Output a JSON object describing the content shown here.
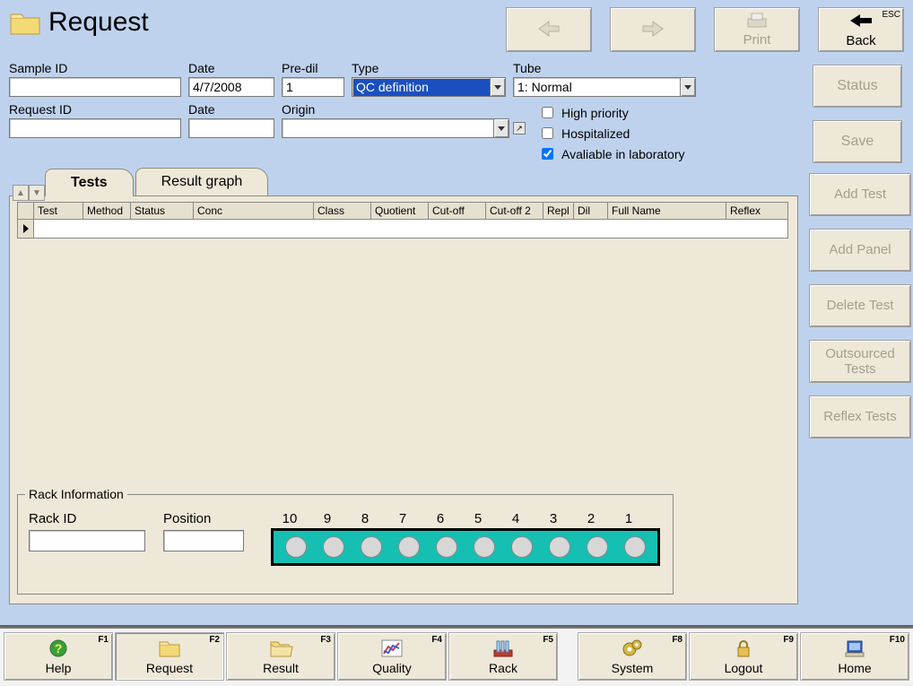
{
  "title": "Request",
  "top_buttons": {
    "prev": "",
    "next": "",
    "print": "Print",
    "back": "Back",
    "back_hotkey": "ESC"
  },
  "fields": {
    "sample_id": {
      "label": "Sample ID",
      "value": ""
    },
    "date1": {
      "label": "Date",
      "value": "4/7/2008"
    },
    "pre_dil": {
      "label": "Pre-dil",
      "value": "1"
    },
    "type": {
      "label": "Type",
      "value": "QC definition"
    },
    "tube": {
      "label": "Tube",
      "value": "1: Normal"
    },
    "request_id": {
      "label": "Request ID",
      "value": ""
    },
    "date2": {
      "label": "Date",
      "value": ""
    },
    "origin": {
      "label": "Origin",
      "value": ""
    }
  },
  "checks": {
    "high_priority": {
      "label": "High priority",
      "checked": false
    },
    "hospitalized": {
      "label": "Hospitalized",
      "checked": false
    },
    "available_lab": {
      "label": "Avaliable in laboratory",
      "checked": true
    }
  },
  "side_top": {
    "status": "Status",
    "save": "Save"
  },
  "tabs": {
    "tests": "Tests",
    "result_graph": "Result graph"
  },
  "table": {
    "headers": {
      "test": "Test",
      "method": "Method",
      "status": "Status",
      "conc": "Conc",
      "class": "Class",
      "quotient": "Quotient",
      "cutoff": "Cut-off",
      "cutoff2": "Cut-off 2",
      "repl": "Repl",
      "dil": "Dil",
      "fullname": "Full Name",
      "reflex": "Reflex"
    }
  },
  "test_buttons": {
    "add_test": "Add Test",
    "add_panel": "Add Panel",
    "delete_test": "Delete Test",
    "outsourced": "Outsourced Tests",
    "reflex": "Reflex Tests"
  },
  "rack": {
    "legend": "Rack Information",
    "rack_id_label": "Rack ID",
    "rack_id_value": "",
    "position_label": "Position",
    "position_value": "",
    "numbers": [
      "10",
      "9",
      "8",
      "7",
      "6",
      "5",
      "4",
      "3",
      "2",
      "1"
    ]
  },
  "bottom": {
    "help": {
      "label": "Help",
      "hot": "F1"
    },
    "request": {
      "label": "Request",
      "hot": "F2"
    },
    "result": {
      "label": "Result",
      "hot": "F3"
    },
    "quality": {
      "label": "Quality",
      "hot": "F4"
    },
    "rack": {
      "label": "Rack",
      "hot": "F5"
    },
    "system": {
      "label": "System",
      "hot": "F8"
    },
    "logout": {
      "label": "Logout",
      "hot": "F9"
    },
    "home": {
      "label": "Home",
      "hot": "F10"
    }
  }
}
